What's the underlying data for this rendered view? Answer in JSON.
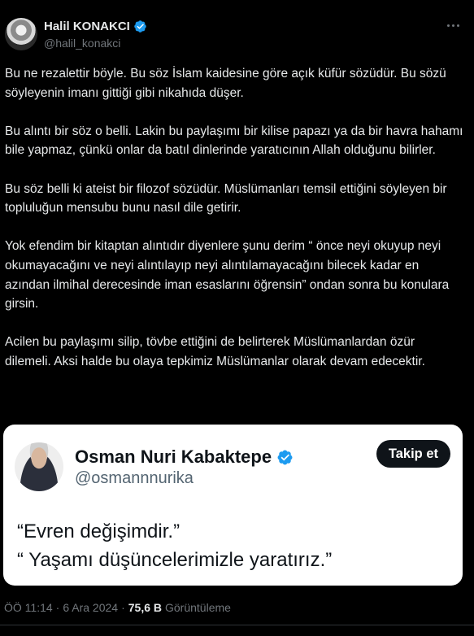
{
  "author": {
    "display_name": "Halil KONAKCI",
    "handle": "@halil_konakci",
    "verified": true,
    "avatar_icon": "profile-photo"
  },
  "more_icon": "more-options-icon",
  "tweet": {
    "paragraphs": [
      "Bu ne rezalettir böyle. Bu söz İslam kaidesine göre açık küfür sözüdür. Bu sözü söyleyenin imanı gittiği gibi nikahıda düşer.",
      "Bu alıntı bir söz o belli. Lakin bu paylaşımı bir kilise papazı ya da bir havra hahamı bile yapmaz, çünkü onlar da batıl dinlerinde yaratıcının Allah olduğunu bilirler.",
      "Bu söz belli ki ateist bir filozof sözüdür. Müslümanları temsil ettiğini söyleyen bir topluluğun mensubu bunu nasıl dile getirir.",
      "Yok efendim bir kitaptan alıntıdır diyenlere şunu derim “ önce neyi okuyup neyi okumayacağını ve neyi alıntılayıp neyi alıntılamayacağını bilecek kadar en azından ilmihal derecesinde iman esaslarını öğrensin” ondan sonra bu konulara girsin.",
      "Acilen bu paylaşımı silip, tövbe ettiğini de belirterek Müslümanlardan özür dilemeli. Aksi halde bu olaya tepkimiz Müslümanlar olarak devam edecektir."
    ]
  },
  "quoted": {
    "display_name": "Osman Nuri Kabaktepe",
    "handle": "@osmannnurika",
    "verified": true,
    "follow_label": "Takip et",
    "lines": [
      "“Evren değişimdir.”",
      "“ Yaşamı düşüncelerimizle yaratırız.”"
    ]
  },
  "meta": {
    "time": "ÖÖ 11:14",
    "separator": "·",
    "date": "6 Ara 2024",
    "views_count": "75,6 B",
    "views_label": "Görüntüleme"
  },
  "colors": {
    "background": "#000000",
    "text": "#e7e9ea",
    "muted": "#71767b",
    "verified": "#1d9bf0",
    "card_bg": "#ffffff",
    "button_bg": "#0f1419"
  }
}
